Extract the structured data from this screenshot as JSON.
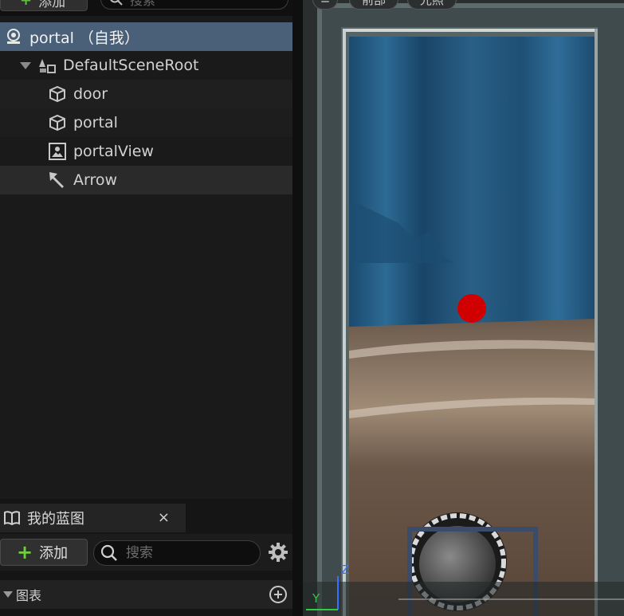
{
  "toolbar_top": {
    "add_label": "添加",
    "search_placeholder": "搜索"
  },
  "tree": {
    "items": [
      {
        "label": "portal （自我）",
        "icon": "actor-icon"
      },
      {
        "label": "DefaultSceneRoot",
        "icon": "scene-root-icon"
      },
      {
        "label": "door",
        "icon": "static-mesh-icon"
      },
      {
        "label": "portal",
        "icon": "static-mesh-icon"
      },
      {
        "label": "portalView",
        "icon": "scene-capture-icon"
      },
      {
        "label": "Arrow",
        "icon": "arrow-icon"
      }
    ]
  },
  "blueprint_panel": {
    "tab_label": "我的蓝图",
    "close_label": "×",
    "add_label": "添加",
    "search_placeholder": "搜索",
    "section_label": "图表"
  },
  "viewport": {
    "buttons": [
      "前部",
      "光照"
    ],
    "axis_y": "Y",
    "axis_z": "Z"
  },
  "colors": {
    "selection": "#4a6078",
    "accent_green": "#5fbf3b",
    "red_sphere": "#d10000"
  }
}
